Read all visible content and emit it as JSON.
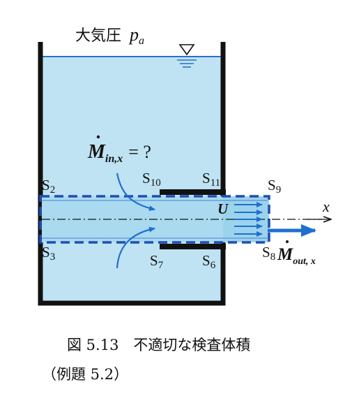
{
  "atmosphere": {
    "label": "大気圧",
    "symbol": "p",
    "subscript": "a"
  },
  "inflow": {
    "symbol": "M",
    "subscript": "in,x",
    "equals": "= ?"
  },
  "outflow": {
    "symbol": "M",
    "subscript": "out, x"
  },
  "velocity": {
    "symbol": "U"
  },
  "axis": {
    "label": "x"
  },
  "surfaces": {
    "s2": {
      "letter": "S",
      "index": "2"
    },
    "s3": {
      "letter": "S",
      "index": "3"
    },
    "s6": {
      "letter": "S",
      "index": "6"
    },
    "s7": {
      "letter": "S",
      "index": "7"
    },
    "s8": {
      "letter": "S",
      "index": "8"
    },
    "s9": {
      "letter": "S",
      "index": "9"
    },
    "s10": {
      "letter": "S",
      "index": "10"
    },
    "s11": {
      "letter": "S",
      "index": "11"
    }
  },
  "caption": {
    "line1": "図 5.13　不適切な検査体積",
    "line2": "（例題 5.2）"
  },
  "colors": {
    "water": "#bfe3f3",
    "jet": "#9cd3ec",
    "wall": "#111111",
    "control_volume": "#1f4fb3",
    "surface_line": "#4a7fd6",
    "flow_arrow": "#1f6fd0"
  }
}
